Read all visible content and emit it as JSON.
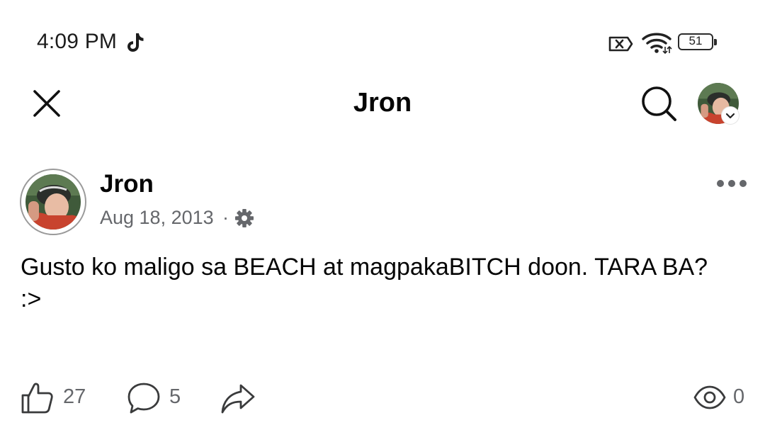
{
  "status_bar": {
    "time": "4:09 PM",
    "battery": "51",
    "icons": [
      "tiktok-icon",
      "sim-x-icon",
      "wifi-icon",
      "battery-icon"
    ]
  },
  "header": {
    "title": "Jron",
    "close_icon": "close-icon",
    "search_icon": "search-icon"
  },
  "post": {
    "author": "Jron",
    "date": "Aug 18, 2013",
    "separator": "·",
    "privacy_icon": "gear-icon",
    "text": "Gusto ko maligo sa BEACH at magpakaBITCH doon. TARA BA? :>",
    "likes": "27",
    "comments": "5",
    "views": "0"
  },
  "colors": {
    "primary_text": "#050505",
    "secondary_text": "#65676b",
    "background": "#ffffff"
  }
}
